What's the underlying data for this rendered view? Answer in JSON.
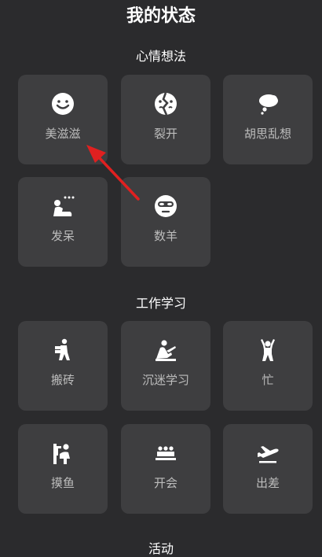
{
  "header": {
    "title": "我的状态"
  },
  "sections": [
    {
      "title": "心情想法",
      "items": [
        {
          "label": "美滋滋",
          "icon": "smiley-face-icon"
        },
        {
          "label": "裂开",
          "icon": "cracked-face-icon"
        },
        {
          "label": "胡思乱想",
          "icon": "thought-bubble-icon"
        },
        {
          "label": "发呆",
          "icon": "daydreaming-person-icon"
        },
        {
          "label": "数羊",
          "icon": "sleep-mask-face-icon"
        }
      ]
    },
    {
      "title": "工作学习",
      "items": [
        {
          "label": "搬砖",
          "icon": "carrying-bricks-icon"
        },
        {
          "label": "沉迷学习",
          "icon": "studying-person-icon"
        },
        {
          "label": "忙",
          "icon": "busy-person-icon"
        },
        {
          "label": "摸鱼",
          "icon": "slacking-person-icon"
        },
        {
          "label": "开会",
          "icon": "meeting-people-icon"
        },
        {
          "label": "出差",
          "icon": "airplane-icon"
        }
      ]
    },
    {
      "title": "活动"
    }
  ],
  "colors": {
    "background": "#2b2b2d",
    "tile": "#3e3e40",
    "label": "#bdbdbd",
    "annotation_arrow": "#e02020"
  }
}
